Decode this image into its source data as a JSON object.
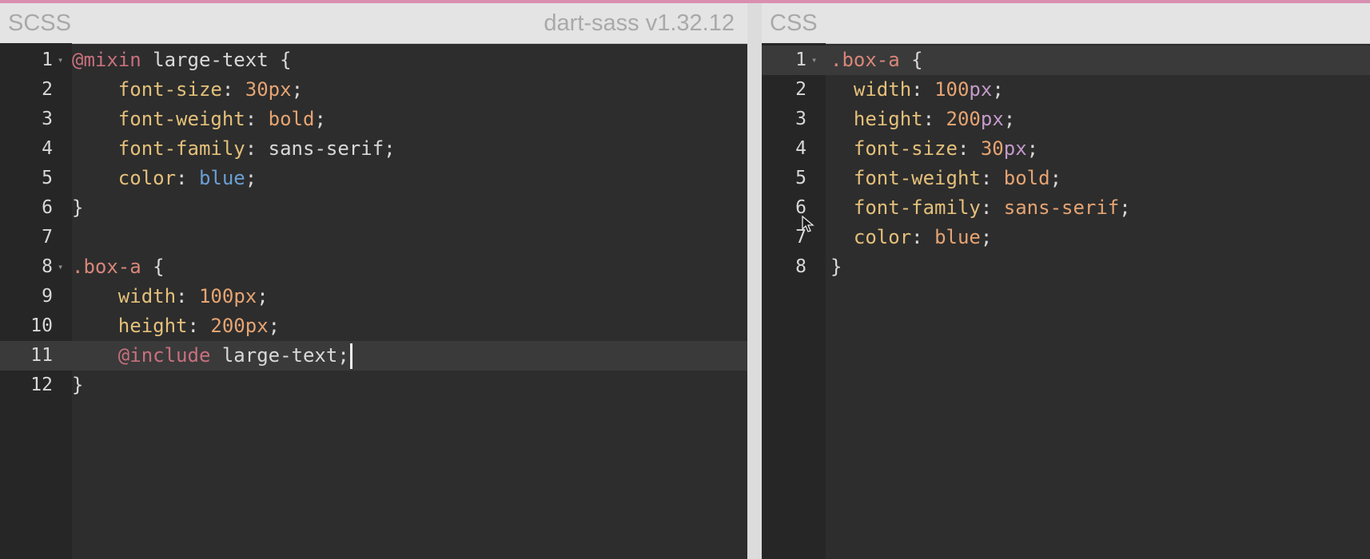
{
  "colors": {
    "accent": "#d98fb0",
    "keyword": "#c8707e",
    "property": "#e4c07a",
    "number": "#e6a472",
    "unit": "#c39ac9",
    "value": "#e6a472",
    "color_value": "#6a9fd4",
    "selector": "#d9867a",
    "plain": "#d9d9d9"
  },
  "scss_pane": {
    "title": "SCSS",
    "version": "dart-sass v1.32.12",
    "active_line": 11,
    "lines": [
      {
        "num": "1",
        "fold": true,
        "indent": "",
        "tokens": [
          {
            "t": "@mixin",
            "c": "keyword"
          },
          {
            "t": " large-text {",
            "c": "plain"
          }
        ]
      },
      {
        "num": "2",
        "indent": "    ",
        "tokens": [
          {
            "t": "font-size",
            "c": "property"
          },
          {
            "t": ": ",
            "c": "plain"
          },
          {
            "t": "30",
            "c": "number"
          },
          {
            "t": "px",
            "c": "number"
          },
          {
            "t": ";",
            "c": "plain"
          }
        ]
      },
      {
        "num": "3",
        "indent": "    ",
        "tokens": [
          {
            "t": "font-weight",
            "c": "property"
          },
          {
            "t": ": ",
            "c": "plain"
          },
          {
            "t": "bold",
            "c": "value"
          },
          {
            "t": ";",
            "c": "plain"
          }
        ]
      },
      {
        "num": "4",
        "indent": "    ",
        "tokens": [
          {
            "t": "font-family",
            "c": "property"
          },
          {
            "t": ": sans-serif;",
            "c": "plain"
          }
        ]
      },
      {
        "num": "5",
        "indent": "    ",
        "tokens": [
          {
            "t": "color",
            "c": "property"
          },
          {
            "t": ": ",
            "c": "plain"
          },
          {
            "t": "blue",
            "c": "color_value"
          },
          {
            "t": ";",
            "c": "plain"
          }
        ]
      },
      {
        "num": "6",
        "indent": "",
        "tokens": [
          {
            "t": "}",
            "c": "plain"
          }
        ]
      },
      {
        "num": "7",
        "indent": "",
        "tokens": []
      },
      {
        "num": "8",
        "fold": true,
        "indent": "",
        "tokens": [
          {
            "t": ".box-a",
            "c": "selector"
          },
          {
            "t": " {",
            "c": "plain"
          }
        ]
      },
      {
        "num": "9",
        "indent": "    ",
        "tokens": [
          {
            "t": "width",
            "c": "property"
          },
          {
            "t": ": ",
            "c": "plain"
          },
          {
            "t": "100",
            "c": "number"
          },
          {
            "t": "px",
            "c": "number"
          },
          {
            "t": ";",
            "c": "plain"
          }
        ]
      },
      {
        "num": "10",
        "indent": "    ",
        "tokens": [
          {
            "t": "height",
            "c": "property"
          },
          {
            "t": ": ",
            "c": "plain"
          },
          {
            "t": "200",
            "c": "number"
          },
          {
            "t": "px",
            "c": "number"
          },
          {
            "t": ";",
            "c": "plain"
          }
        ]
      },
      {
        "num": "11",
        "indent": "    ",
        "cursor": true,
        "tokens": [
          {
            "t": "@include",
            "c": "keyword"
          },
          {
            "t": " large-text;",
            "c": "plain"
          }
        ]
      },
      {
        "num": "12",
        "indent": "",
        "tokens": [
          {
            "t": "}",
            "c": "plain"
          }
        ]
      }
    ]
  },
  "css_pane": {
    "title": "CSS",
    "active_line": 1,
    "lines": [
      {
        "num": "1",
        "fold": true,
        "indent": "",
        "tokens": [
          {
            "t": ".box-a",
            "c": "selector"
          },
          {
            "t": " {",
            "c": "plain"
          }
        ]
      },
      {
        "num": "2",
        "indent": "  ",
        "tokens": [
          {
            "t": "width",
            "c": "property"
          },
          {
            "t": ": ",
            "c": "plain"
          },
          {
            "t": "100",
            "c": "number"
          },
          {
            "t": "px",
            "c": "unit"
          },
          {
            "t": ";",
            "c": "plain"
          }
        ]
      },
      {
        "num": "3",
        "indent": "  ",
        "tokens": [
          {
            "t": "height",
            "c": "property"
          },
          {
            "t": ": ",
            "c": "plain"
          },
          {
            "t": "200",
            "c": "number"
          },
          {
            "t": "px",
            "c": "unit"
          },
          {
            "t": ";",
            "c": "plain"
          }
        ]
      },
      {
        "num": "4",
        "indent": "  ",
        "tokens": [
          {
            "t": "font-size",
            "c": "property"
          },
          {
            "t": ": ",
            "c": "plain"
          },
          {
            "t": "30",
            "c": "number"
          },
          {
            "t": "px",
            "c": "unit"
          },
          {
            "t": ";",
            "c": "plain"
          }
        ]
      },
      {
        "num": "5",
        "indent": "  ",
        "tokens": [
          {
            "t": "font-weight",
            "c": "property"
          },
          {
            "t": ": ",
            "c": "plain"
          },
          {
            "t": "bold",
            "c": "value"
          },
          {
            "t": ";",
            "c": "plain"
          }
        ]
      },
      {
        "num": "6",
        "indent": "  ",
        "tokens": [
          {
            "t": "font-family",
            "c": "property"
          },
          {
            "t": ": ",
            "c": "plain"
          },
          {
            "t": "sans-serif",
            "c": "value"
          },
          {
            "t": ";",
            "c": "plain"
          }
        ]
      },
      {
        "num": "7",
        "indent": "  ",
        "tokens": [
          {
            "t": "color",
            "c": "property"
          },
          {
            "t": ": ",
            "c": "plain"
          },
          {
            "t": "blue",
            "c": "value"
          },
          {
            "t": ";",
            "c": "plain"
          }
        ]
      },
      {
        "num": "8",
        "indent": "",
        "tokens": [
          {
            "t": "}",
            "c": "plain"
          }
        ]
      }
    ]
  }
}
